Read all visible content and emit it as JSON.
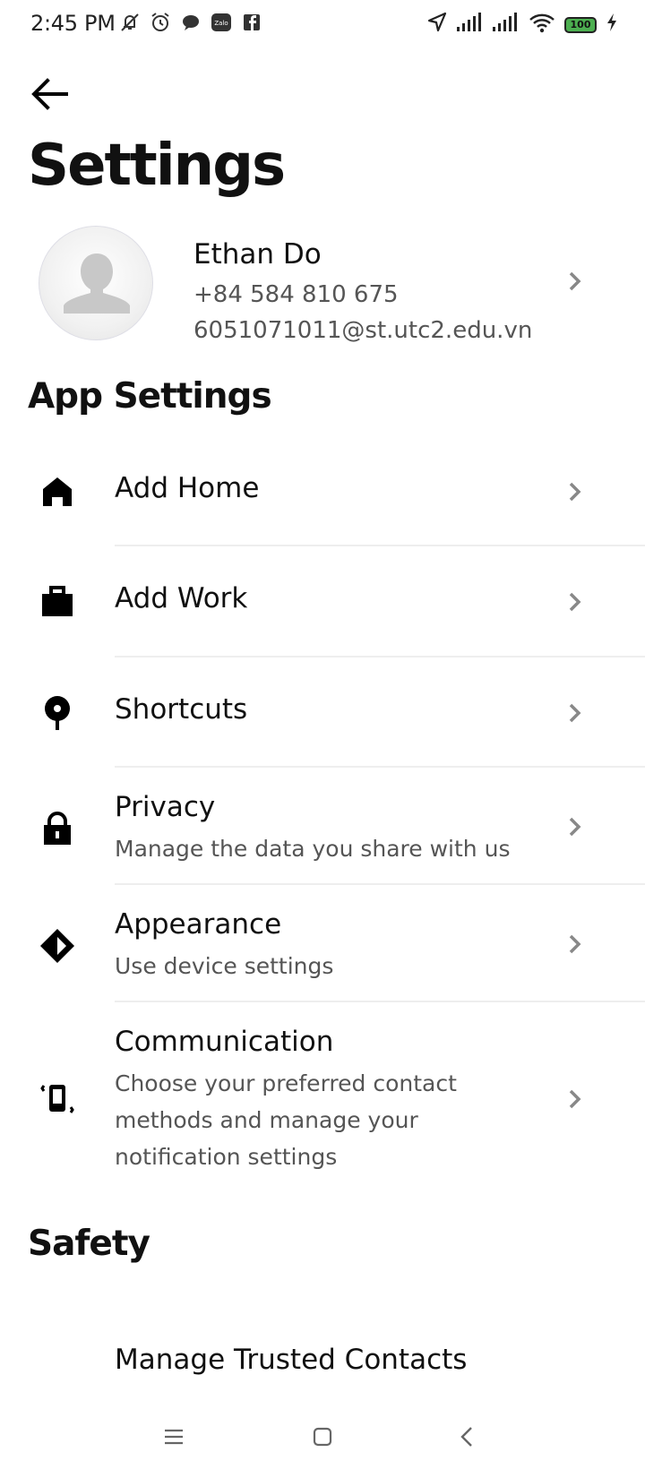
{
  "status_bar": {
    "time": "2:45 PM",
    "battery": "100",
    "left_icons": [
      "mute-icon",
      "alarm-icon",
      "chat-icon",
      "zalo-icon",
      "facebook-icon"
    ],
    "right_icons": [
      "location-icon",
      "signal-icon",
      "signal-icon",
      "wifi-icon",
      "battery-icon",
      "charging-icon"
    ]
  },
  "header": {
    "title": "Settings"
  },
  "profile": {
    "name": "Ethan Do",
    "phone": "+84 584 810 675",
    "email": "6051071011@st.utc2.edu.vn"
  },
  "app_settings": {
    "title": "App Settings",
    "items": [
      {
        "label": "Add Home",
        "icon": "home-icon"
      },
      {
        "label": "Add Work",
        "icon": "briefcase-icon"
      },
      {
        "label": "Shortcuts",
        "icon": "pin-icon"
      },
      {
        "label": "Privacy",
        "subtitle": "Manage the data you share with us",
        "icon": "lock-icon"
      },
      {
        "label": "Appearance",
        "subtitle": "Use device settings",
        "icon": "appearance-icon"
      },
      {
        "label": "Communication",
        "subtitle_lines": [
          "Choose your preferred contact",
          "methods and manage your",
          "notification settings"
        ],
        "icon": "phone-vibrate-icon"
      }
    ]
  },
  "safety": {
    "title": "Safety",
    "items": [
      {
        "label": "Manage Trusted Contacts"
      }
    ]
  },
  "nav_bar": {
    "buttons": [
      "menu-icon",
      "home-square-icon",
      "back-chevron-icon"
    ]
  },
  "colors": {
    "text_primary": "#111111",
    "text_secondary": "#555555",
    "divider": "#eeeeee",
    "chevron": "#888888",
    "battery_fill": "#4caf50"
  }
}
